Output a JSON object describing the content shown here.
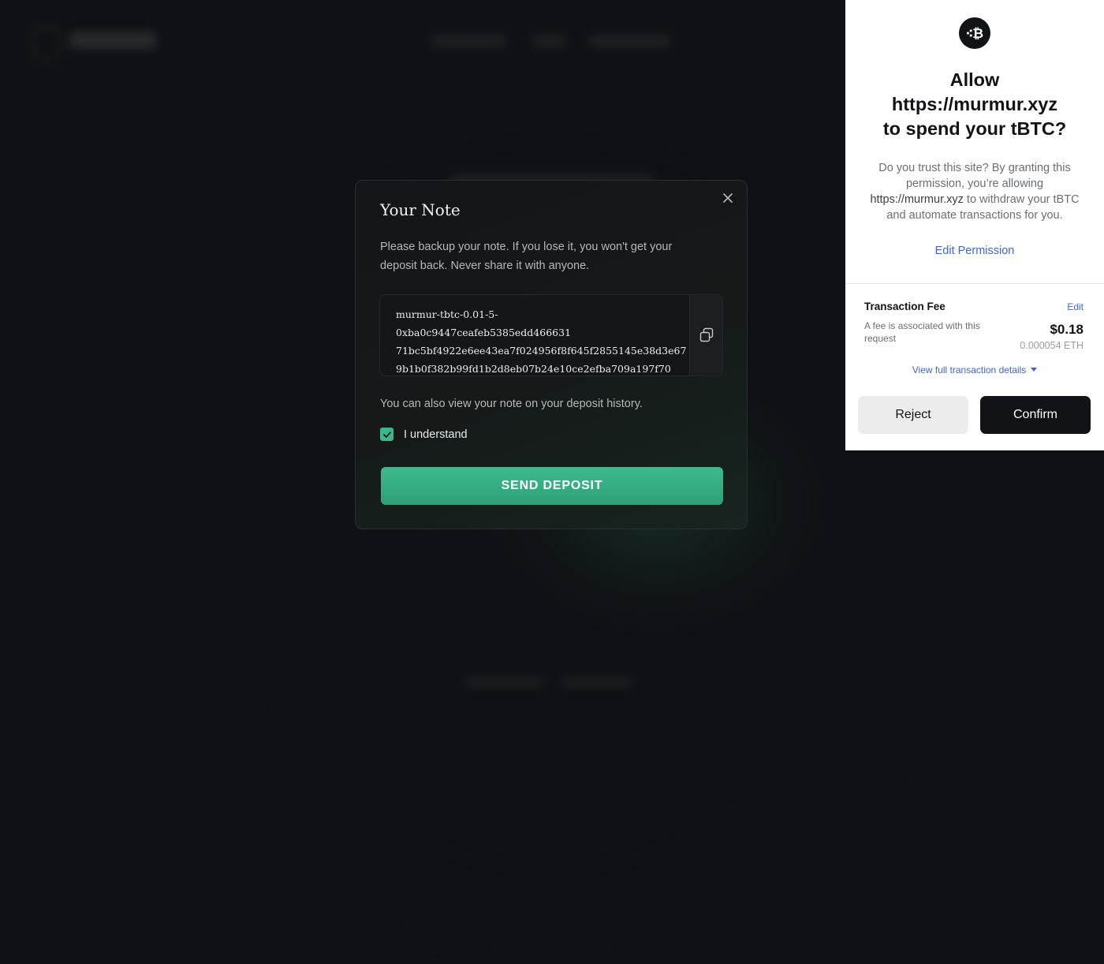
{
  "modal": {
    "title": "Your Note",
    "description": "Please backup your note. If you lose it, you won't get your deposit back. Never share it with anyone.",
    "note_lines": [
      "murmur-tbtc-0.01-5-0xba0c9447ceafeb5385edd466631",
      "71bc5bf4922e6ee43ea7f024956f8f645f2855145e38d3e67",
      "9b1b0f382b99fd1b2d8eb07b24e10ce2efba709a197f70"
    ],
    "history_text": "You can also view your note on your deposit history.",
    "checkbox_label": "I understand",
    "checkbox_checked": true,
    "send_button": "SEND DEPOSIT",
    "accent_color": "#3eb68c"
  },
  "wallet": {
    "logo_icon": "bitcoin-icon",
    "title_lines": [
      "Allow",
      "https://murmur.xyz",
      "to spend your tBTC?"
    ],
    "description_part1": "Do you trust this site? By granting this permission, you’re allowing ",
    "description_site": "https://murmur.xyz",
    "description_part2": " to withdraw your tBTC and automate transactions for you.",
    "edit_permission": "Edit Permission",
    "fee": {
      "title": "Transaction Fee",
      "edit": "Edit",
      "description": "A fee is associated with this request",
      "usd": "$0.18",
      "eth": "0.000054 ETH"
    },
    "view_details": "View full transaction details",
    "reject": "Reject",
    "confirm": "Confirm",
    "link_color": "#3f63e0"
  }
}
